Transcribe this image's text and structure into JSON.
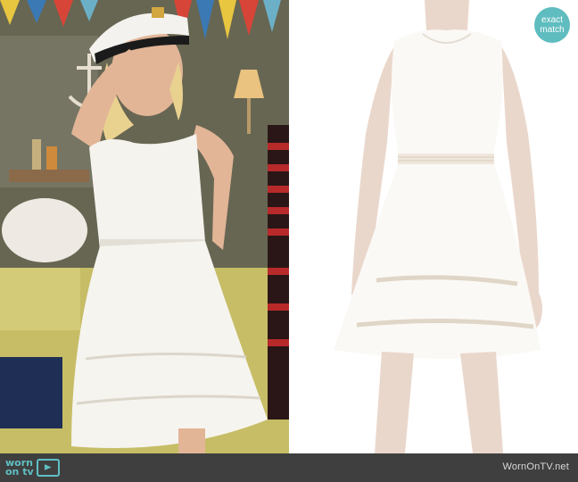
{
  "badge": {
    "line1": "exact",
    "line2": "match"
  },
  "footer": {
    "logo_line1": "worn",
    "logo_line2": "on tv",
    "site": "WornOnTV.net"
  },
  "icons": {
    "logo": "tv-icon"
  }
}
